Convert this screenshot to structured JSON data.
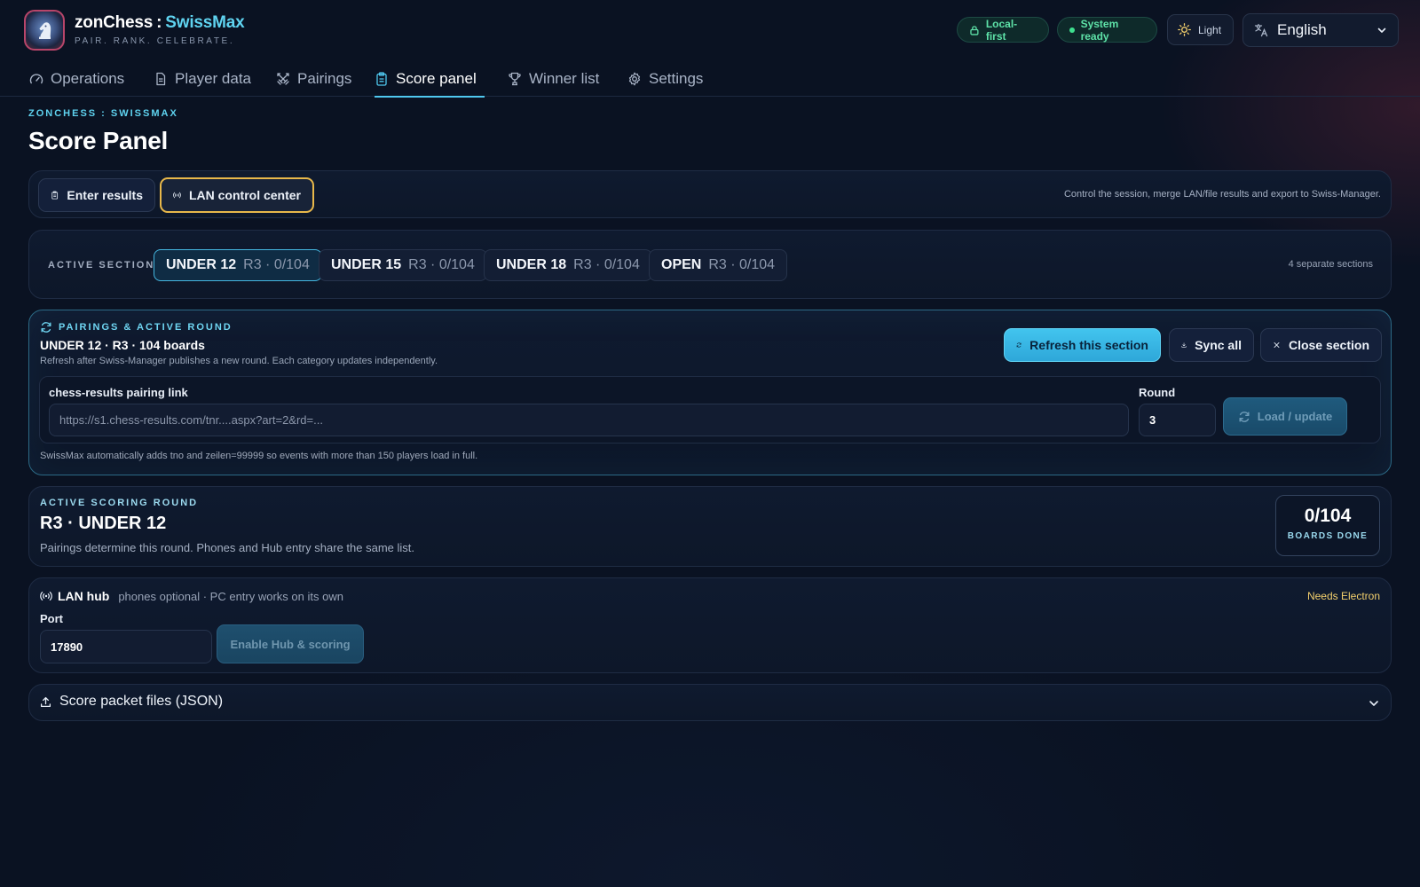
{
  "brand": {
    "title_main": "zonChess",
    "title_sep": ":",
    "title_accent": "SwissMax",
    "tagline": "PAIR. RANK. CELEBRATE."
  },
  "header": {
    "badge_local": "Local-first",
    "badge_ready": "System ready",
    "theme_label": "Light",
    "language": "English"
  },
  "nav": {
    "items": [
      {
        "label": "Operations",
        "icon": "gauge-icon"
      },
      {
        "label": "Player data",
        "icon": "document-icon"
      },
      {
        "label": "Pairings",
        "icon": "swords-icon"
      },
      {
        "label": "Score panel",
        "icon": "clipboard-icon",
        "active": true
      },
      {
        "label": "Winner list",
        "icon": "trophy-icon"
      },
      {
        "label": "Settings",
        "icon": "gear-icon"
      }
    ]
  },
  "page": {
    "eyebrow": "ZONCHESS : SWISSMAX",
    "title": "Score Panel"
  },
  "modes": {
    "enter_results": "Enter results",
    "lan_control": "LAN control center",
    "help": "Control the session, merge LAN/file results and export to Swiss-Manager."
  },
  "sections": {
    "label": "ACTIVE SECTION",
    "items": [
      {
        "name": "UNDER 12",
        "meta": "R3 · 0/104",
        "active": true
      },
      {
        "name": "UNDER 15",
        "meta": "R3 · 0/104"
      },
      {
        "name": "UNDER 18",
        "meta": "R3 · 0/104"
      },
      {
        "name": "OPEN",
        "meta": "R3 · 0/104"
      }
    ],
    "count": "4 separate sections"
  },
  "pairings": {
    "eyebrow": "PAIRINGS & ACTIVE ROUND",
    "title": "UNDER 12 · R3 · 104 boards",
    "subtitle": "Refresh after Swiss-Manager publishes a new round. Each category updates independently.",
    "refresh": "Refresh this section",
    "sync": "Sync all",
    "close": "Close section",
    "link_label": "chess-results pairing link",
    "link_placeholder": "https://s1.chess-results.com/tnr....aspx?art=2&rd=...",
    "round_label": "Round",
    "round_value": "3",
    "load": "Load / update",
    "note": "SwissMax automatically adds tno and zeilen=99999 so events with more than 150 players load in full."
  },
  "active_round": {
    "eyebrow": "ACTIVE SCORING ROUND",
    "title": "R3 · UNDER 12",
    "subtitle": "Pairings determine this round. Phones and Hub entry share the same list.",
    "boards_value": "0/104",
    "boards_label": "BOARDS DONE"
  },
  "lan_hub": {
    "title": "LAN hub",
    "subtitle": "phones optional · PC entry works on its own",
    "flag": "Needs Electron",
    "port_label": "Port",
    "port_value": "17890",
    "enable": "Enable Hub & scoring"
  },
  "score_packet": {
    "title": "Score packet files (JSON)"
  },
  "colors": {
    "accent": "#4fc8ef",
    "warning_outline": "#e8b84a",
    "ok": "#5ee2a8",
    "background": "#0a1222"
  }
}
